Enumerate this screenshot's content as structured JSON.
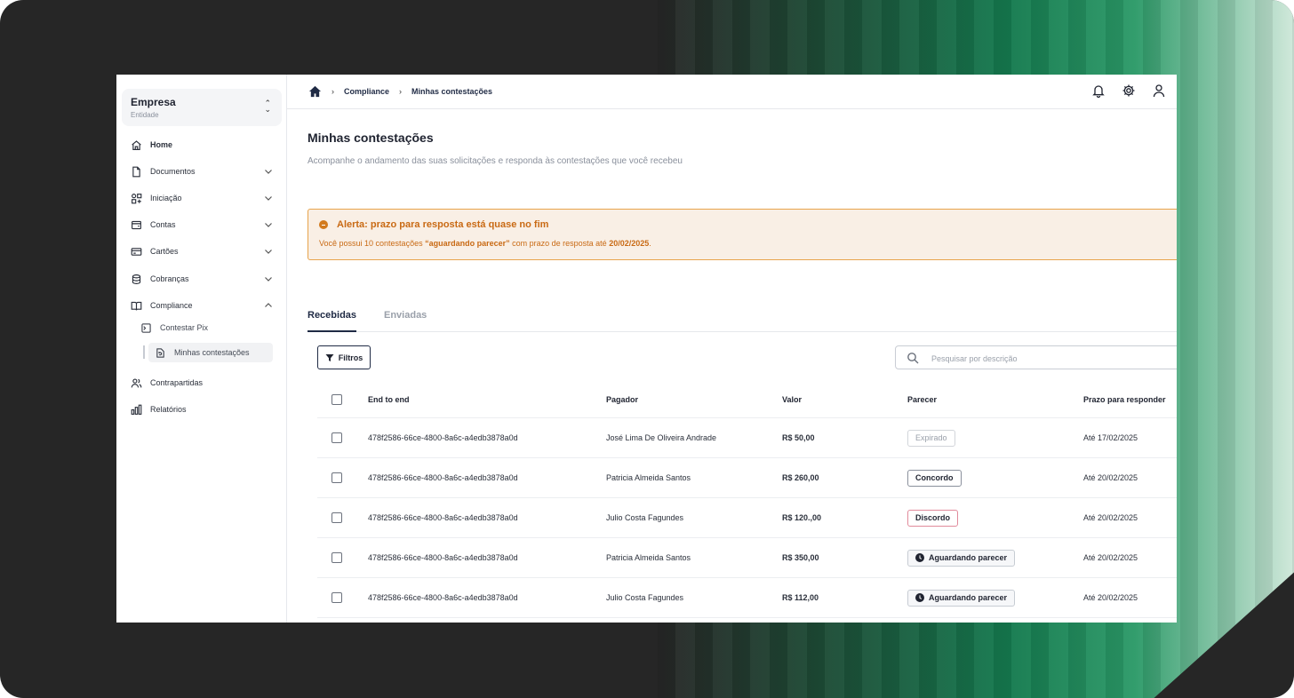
{
  "company": {
    "name": "Empresa",
    "subtitle": "Entidade"
  },
  "sidebar": {
    "items": [
      {
        "label": "Home"
      },
      {
        "label": "Documentos"
      },
      {
        "label": "Iniciação"
      },
      {
        "label": "Contas"
      },
      {
        "label": "Cartões"
      },
      {
        "label": "Cobranças"
      },
      {
        "label": "Compliance"
      },
      {
        "label": "Contrapartidas"
      },
      {
        "label": "Relatórios"
      }
    ],
    "sub_items": [
      {
        "label": "Contestar Pix"
      },
      {
        "label": "Minhas contestações"
      }
    ]
  },
  "breadcrumb": [
    "Compliance",
    "Minhas contestações"
  ],
  "page": {
    "title": "Minhas contestações",
    "subtitle": "Acompanhe o andamento das suas solicitações e responda às contestações que você recebeu"
  },
  "alert": {
    "title": "Alerta: prazo para resposta está quase no fim",
    "msg_prefix": "Você possui 10 contestações ",
    "msg_status": "“aguardando parecer”",
    "msg_middle": " com prazo de resposta até ",
    "msg_date": "20/02/2025",
    "msg_suffix": "."
  },
  "tabs": [
    "Recebidas",
    "Enviadas"
  ],
  "filter_label": "Filtros",
  "search": {
    "placeholder": "Pesquisar por descrição",
    "value": ""
  },
  "table": {
    "headers": [
      "End to end",
      "Pagador",
      "Valor",
      "Parecer",
      "Prazo para responder"
    ],
    "rows": [
      {
        "id": "478f2586-66ce-4800-8a6c-a4edb3878a0d",
        "pagador": "José Lima De Oliveira Andrade",
        "valor": "R$ 50,00",
        "parecer": "Expirado",
        "prazo": "Até 17/02/2025"
      },
      {
        "id": "478f2586-66ce-4800-8a6c-a4edb3878a0d",
        "pagador": "Patricia Almeida Santos",
        "valor": "R$ 260,00",
        "parecer": "Concordo",
        "prazo": "Até 20/02/2025"
      },
      {
        "id": "478f2586-66ce-4800-8a6c-a4edb3878a0d",
        "pagador": "Julio Costa Fagundes",
        "valor": "R$ 120.,00",
        "parecer": "Discordo",
        "prazo": "Até 20/02/2025"
      },
      {
        "id": "478f2586-66ce-4800-8a6c-a4edb3878a0d",
        "pagador": "Patricia Almeida Santos",
        "valor": "R$ 350,00",
        "parecer": "Aguardando parecer",
        "prazo": "Até 20/02/2025"
      },
      {
        "id": "478f2586-66ce-4800-8a6c-a4edb3878a0d",
        "pagador": "Julio Costa Fagundes",
        "valor": "R$ 112,00",
        "parecer": "Aguardando parecer",
        "prazo": "Até 20/02/2025"
      }
    ]
  },
  "icons": [
    "home-icon",
    "bell-icon",
    "gear-icon",
    "user-icon",
    "search-icon",
    "filter-icon",
    "clock-icon",
    "chevron-down-icon",
    "chevron-up-icon"
  ],
  "colors": {
    "brand_dark": "#1f2a44",
    "alert_orange": "#c96a14",
    "alert_bg": "#f9efe5",
    "accent_green": "#157a4f"
  }
}
